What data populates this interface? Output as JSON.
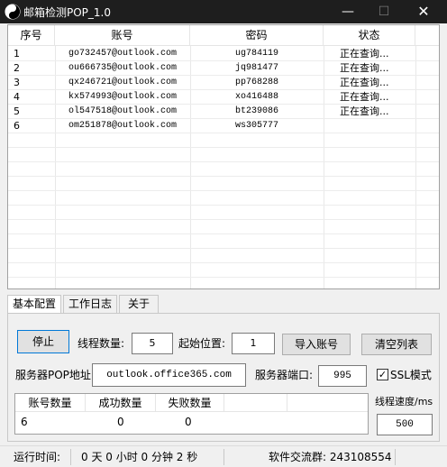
{
  "window": {
    "title": "邮箱检测POP_1.0",
    "icon": "yin-yang-icon",
    "controls": {
      "minimize": "—",
      "maximize": "☐",
      "close": "✕"
    }
  },
  "listview": {
    "columns": [
      "序号",
      "账号",
      "密码",
      "状态"
    ],
    "rows": [
      {
        "index": "1",
        "account": "go732457@outlook.com",
        "password": "ug784119",
        "status": "正在查询..."
      },
      {
        "index": "2",
        "account": "ou666735@outlook.com",
        "password": "jq981477",
        "status": "正在查询..."
      },
      {
        "index": "3",
        "account": "qx246721@outlook.com",
        "password": "pp768288",
        "status": "正在查询..."
      },
      {
        "index": "4",
        "account": "kx574993@outlook.com",
        "password": "xo416488",
        "status": "正在查询..."
      },
      {
        "index": "5",
        "account": "ol547518@outlook.com",
        "password": "bt239086",
        "status": "正在查询..."
      },
      {
        "index": "6",
        "account": "om251878@outlook.com",
        "password": "ws305777",
        "status": ""
      }
    ]
  },
  "tabs": [
    {
      "label": "基本配置",
      "active": true
    },
    {
      "label": "工作日志",
      "active": false
    },
    {
      "label": "关于",
      "active": false
    }
  ],
  "config": {
    "stop_button": "停止",
    "thread_count_label": "线程数量:",
    "thread_count_value": "5",
    "start_pos_label": "起始位置:",
    "start_pos_value": "1",
    "import_button": "导入账号",
    "clear_button": "清空列表",
    "server_label": "服务器POP地址:",
    "server_value": "outlook.office365.com",
    "port_label": "服务器端口:",
    "port_value": "995",
    "ssl_label": "SSL模式",
    "ssl_checked": true,
    "speed_label": "线程速度/ms",
    "speed_value": "500"
  },
  "stats": {
    "columns": [
      "账号数量",
      "成功数量",
      "失败数量"
    ],
    "values": [
      "6",
      "0",
      "0"
    ]
  },
  "statusbar": {
    "runtime_label": "运行时间:",
    "runtime_value": "0 天 0 小时 0 分钟 2 秒",
    "group_text": "软件交流群: 243108554"
  },
  "colors": {
    "titlebar": "#1e1e1e",
    "window_bg": "#f0f0f0",
    "accent_border": "#0078d7"
  }
}
